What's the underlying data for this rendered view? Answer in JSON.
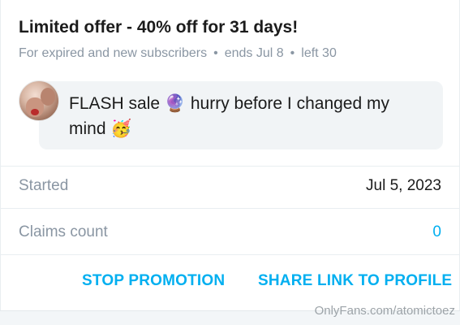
{
  "offer": {
    "title": "Limited offer - 40% off for 31 days!",
    "audience": "For expired and new subscribers",
    "separator": "•",
    "ends": "ends Jul 8",
    "left": "left 30"
  },
  "message": {
    "text": "FLASH sale 🔮 hurry before I changed my mind 🥳",
    "avatar_icon": "creator-avatar"
  },
  "details": {
    "started_label": "Started",
    "started_value": "Jul 5, 2023",
    "claims_label": "Claims count",
    "claims_value": "0"
  },
  "actions": {
    "stop": "STOP PROMOTION",
    "share": "SHARE LINK TO PROFILE"
  },
  "watermark": "OnlyFans.com/atomictoez",
  "colors": {
    "accent": "#00aff0",
    "muted": "#8a96a3",
    "bubble": "#f1f4f6"
  }
}
